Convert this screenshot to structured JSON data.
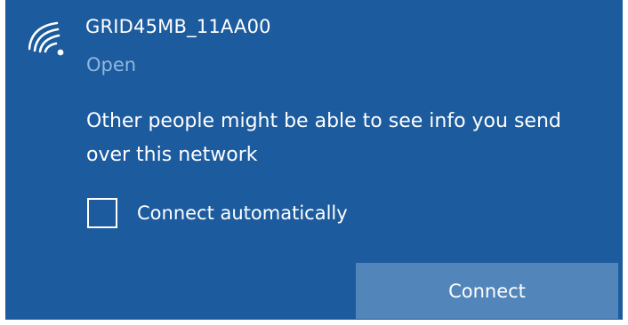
{
  "network": {
    "ssid": "GRID45MB_11AA00",
    "status": "Open",
    "signal_icon": "wifi-signal-icon"
  },
  "warning_text": "Other people might be able to see info you send over this network",
  "connect_automatically": {
    "label": "Connect automatically",
    "checked": false
  },
  "connect_button": {
    "label": "Connect"
  },
  "colors": {
    "panel_background": "#1c5b9e",
    "button_background": "#5286ba",
    "secondary_text": "#90b8dd",
    "text": "#ffffff"
  }
}
